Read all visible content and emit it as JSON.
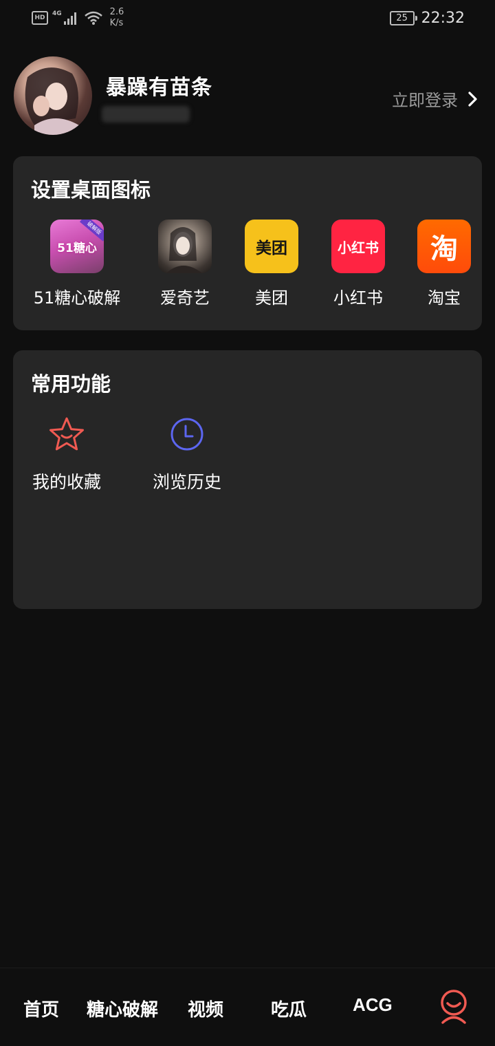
{
  "status_bar": {
    "hd": "HD",
    "network_type": "4G",
    "net_speed_value": "2.6",
    "net_speed_unit": "K/s",
    "battery": "25",
    "time": "22:32"
  },
  "profile": {
    "username": "暴躁有苗条",
    "login_label": "立即登录"
  },
  "desktop_icons": {
    "title": "设置桌面图标",
    "apps": [
      {
        "label": "51糖心破解",
        "icon_text": "51糖心",
        "badge_text": "破解版",
        "color": "#c94fb0"
      },
      {
        "label": "爱奇艺",
        "icon_text": "",
        "color": "#8b7f75"
      },
      {
        "label": "美团",
        "icon_text": "美团",
        "color": "#f6c11b"
      },
      {
        "label": "小红书",
        "icon_text": "小红书",
        "color": "#ff2442"
      },
      {
        "label": "淘宝",
        "icon_text": "淘",
        "color": "#ff5a00"
      }
    ]
  },
  "common_functions": {
    "title": "常用功能",
    "items": [
      {
        "label": "我的收藏",
        "icon": "star-icon",
        "color": "#f05a52"
      },
      {
        "label": "浏览历史",
        "icon": "clock-icon",
        "color": "#5c66f0"
      }
    ]
  },
  "bottom_nav": {
    "items": [
      "首页",
      "糖心破解",
      "视频",
      "吃瓜",
      "ACG"
    ],
    "profile_icon": "smiley-user-icon",
    "active_color": "#f05a52"
  },
  "colors": {
    "background": "#0f0f0f",
    "card": "#262626",
    "text_primary": "#ffffff",
    "text_secondary": "#9a9a9a"
  }
}
